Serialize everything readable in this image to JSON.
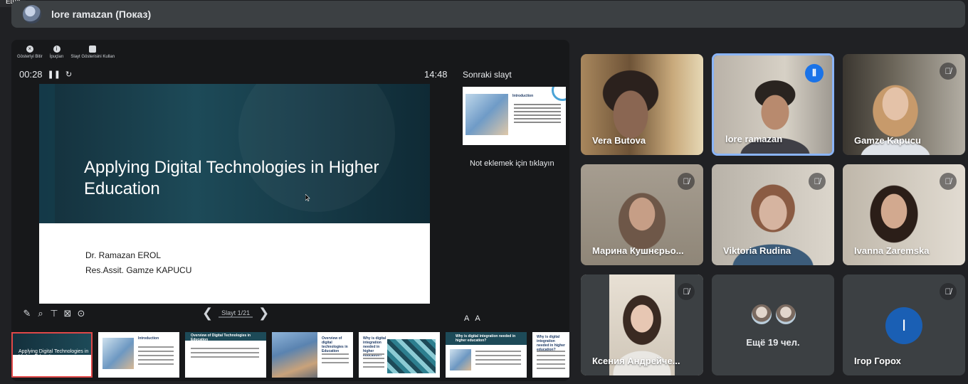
{
  "overlay_tag": "Ещё",
  "header": {
    "title": "lore ramazan (Показ)"
  },
  "presenter": {
    "toolbar": [
      {
        "label": "Gösteriyi Bitir",
        "icon": "close-icon"
      },
      {
        "label": "İpuçları",
        "icon": "info-icon"
      },
      {
        "label": "Slayt Gösterisini Kullan",
        "icon": "slideshow-icon"
      }
    ],
    "elapsed": "00:28",
    "clock": "14:48",
    "slide": {
      "title": "Applying Digital Technologies in Higher Education",
      "authors": [
        "Dr. Ramazan EROL",
        "Res.Assit. Gamze KAPUCU"
      ]
    },
    "next_label": "Sonraki slayt",
    "next_thumb_title": "Introduction",
    "notes_placeholder": "Not eklemek için tıklayın",
    "slide_counter": "Slayt 1/21",
    "font_controls": [
      "A",
      "A"
    ],
    "thumbnails": [
      {
        "title": "Applying Digital Technologies in Higher Education",
        "active": true
      },
      {
        "title": "Introduction"
      },
      {
        "title": "Overview of Digital Technologies in Education"
      },
      {
        "title": "Overview of digital technologies in Education"
      },
      {
        "title": "Why is digital integration needed in higher education?"
      },
      {
        "title": "Why is digital integration needed in higher education?"
      },
      {
        "title": "Why is digital integration needed in higher education?"
      }
    ]
  },
  "participants": [
    {
      "name": "Vera Butova",
      "muted": false,
      "speaking": false
    },
    {
      "name": "lore ramazan",
      "muted": false,
      "speaking": true
    },
    {
      "name": "Gamze Kapucu",
      "muted": true
    },
    {
      "name": "Марина Кушнєрьо...",
      "muted": true
    },
    {
      "name": "Viktoria Rudina",
      "muted": true
    },
    {
      "name": "Ivanna Zaremska",
      "muted": true
    },
    {
      "name": "Ксения Андрейче...",
      "muted": true
    },
    {
      "name": "Ещё 19 чел."
    },
    {
      "name": "Ігор Горох",
      "muted": true,
      "initial": "I"
    }
  ],
  "colors": {
    "accent": "#1a73e8",
    "active_border": "#8ab4f8",
    "bg": "#202124",
    "tile": "#3c4043"
  }
}
